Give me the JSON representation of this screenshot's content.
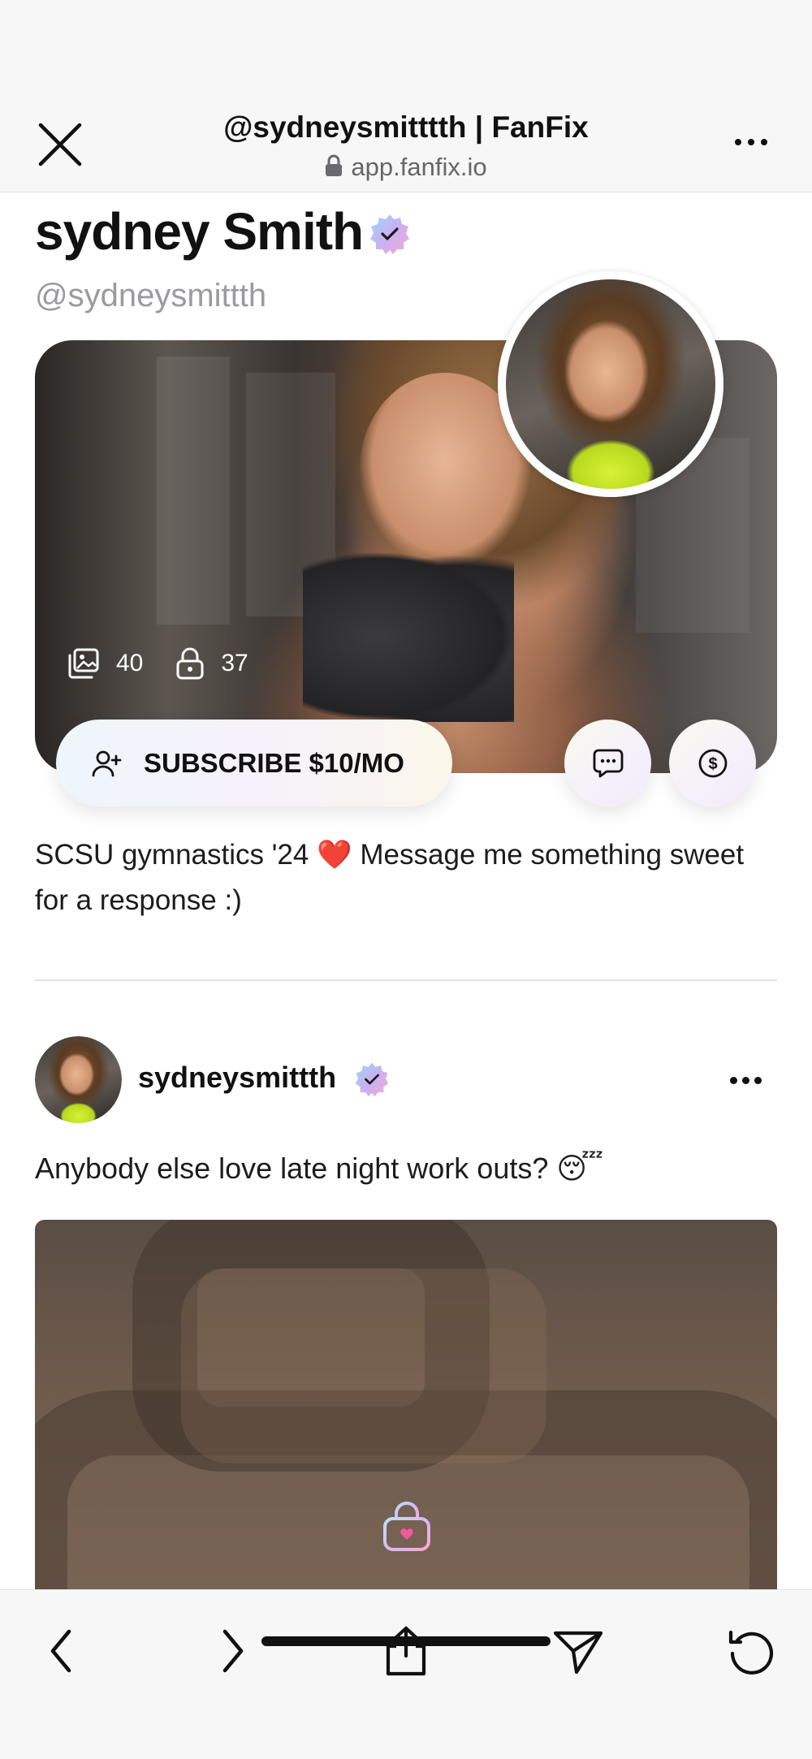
{
  "browser": {
    "title": "@sydneysmitttth | FanFix",
    "url": "app.fanfix.io"
  },
  "profile": {
    "name": "sydney Smith",
    "handle": "@sydneysmittth",
    "media_count": "40",
    "locked_count": "37",
    "subscribe_label": "SUBSCRIBE $10/MO",
    "bio_before_emoji": "SCSU gymnastics '24 ",
    "bio_emoji": "❤️",
    "bio_after_emoji": " Message me something sweet for a response :)"
  },
  "post": {
    "username": "sydneysmittth",
    "text": "Anybody else love late night work outs? 😴"
  },
  "icons": {
    "close": "close-icon",
    "more": "more-horizontal-icon",
    "lock": "lock-icon",
    "verified": "verified-badge-icon",
    "media": "image-stack-icon",
    "locked_posts": "padlock-icon",
    "subscribe": "add-user-icon",
    "message": "chat-bubble-icon",
    "tip": "dollar-coin-icon",
    "back": "chevron-left-icon",
    "forward": "chevron-right-icon",
    "share": "share-icon",
    "send": "send-icon",
    "reload": "reload-icon"
  },
  "colors": {
    "heart": "#d31f28",
    "verified_gradient_start": "#9bd8f5",
    "verified_gradient_end": "#f3a8d6"
  }
}
